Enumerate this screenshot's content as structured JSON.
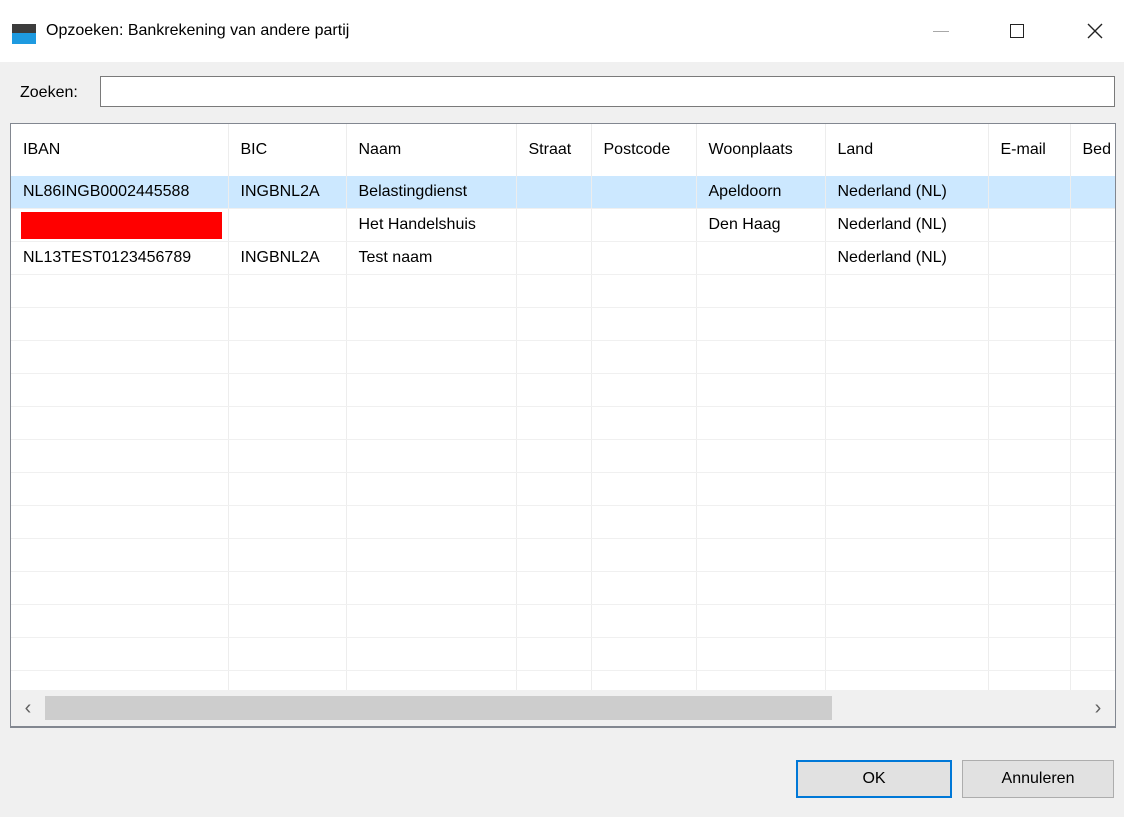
{
  "window": {
    "title": "Opzoeken: Bankrekening van andere partij",
    "controls": {
      "minimize": "minimize",
      "maximize": "maximize",
      "close": "×"
    }
  },
  "search": {
    "label": "Zoeken:",
    "value": "",
    "placeholder": ""
  },
  "table": {
    "columns": [
      "IBAN",
      "BIC",
      "Naam",
      "Straat",
      "Postcode",
      "Woonplaats",
      "Land",
      "E-mail",
      "Bed"
    ],
    "rows": [
      [
        "NL86INGB0002445588",
        "INGBNL2A",
        "Belastingdienst",
        "",
        "",
        "Apeldoorn",
        "Nederland (NL)",
        "",
        ""
      ],
      [
        "",
        "",
        "Het Handelshuis",
        "",
        "",
        "Den Haag",
        "Nederland (NL)",
        "",
        ""
      ],
      [
        "NL13TEST0123456789",
        "INGBNL2A",
        "Test naam",
        "",
        "",
        "",
        "Nederland (NL)",
        "",
        ""
      ]
    ],
    "selected_row": 0,
    "empty_row_count": 13
  },
  "scrollbar": {
    "left_arrow": "‹",
    "right_arrow": "›"
  },
  "buttons": {
    "ok": "OK",
    "cancel": "Annuleren"
  },
  "colors": {
    "selection": "#cce8ff",
    "accent": "#0078d7",
    "redaction": "#ff0000"
  }
}
